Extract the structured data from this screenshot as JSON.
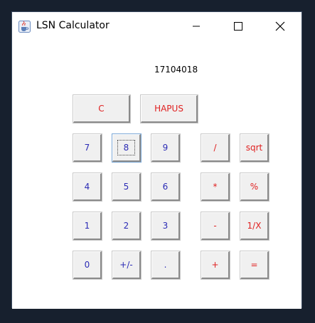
{
  "window": {
    "title": "LSN Calculator",
    "app_icon": "java-coffee-cup-icon"
  },
  "display": {
    "value": "17104018"
  },
  "buttons": {
    "clear": "C",
    "hapus": "HAPUS",
    "seven": "7",
    "eight": "8",
    "nine": "9",
    "divide": "/",
    "sqrt": "sqrt",
    "four": "4",
    "five": "5",
    "six": "6",
    "multiply": "*",
    "percent": "%",
    "one": "1",
    "two": "2",
    "three": "3",
    "minus": "-",
    "reciprocal": "1/X",
    "zero": "0",
    "plusminus": "+/-",
    "dot": ".",
    "plus": "+",
    "equals": "="
  },
  "colors": {
    "digit_text": "#2b2bb5",
    "operator_text": "#e02020",
    "button_face": "#f0f0f0",
    "desktop": "#17202e"
  }
}
